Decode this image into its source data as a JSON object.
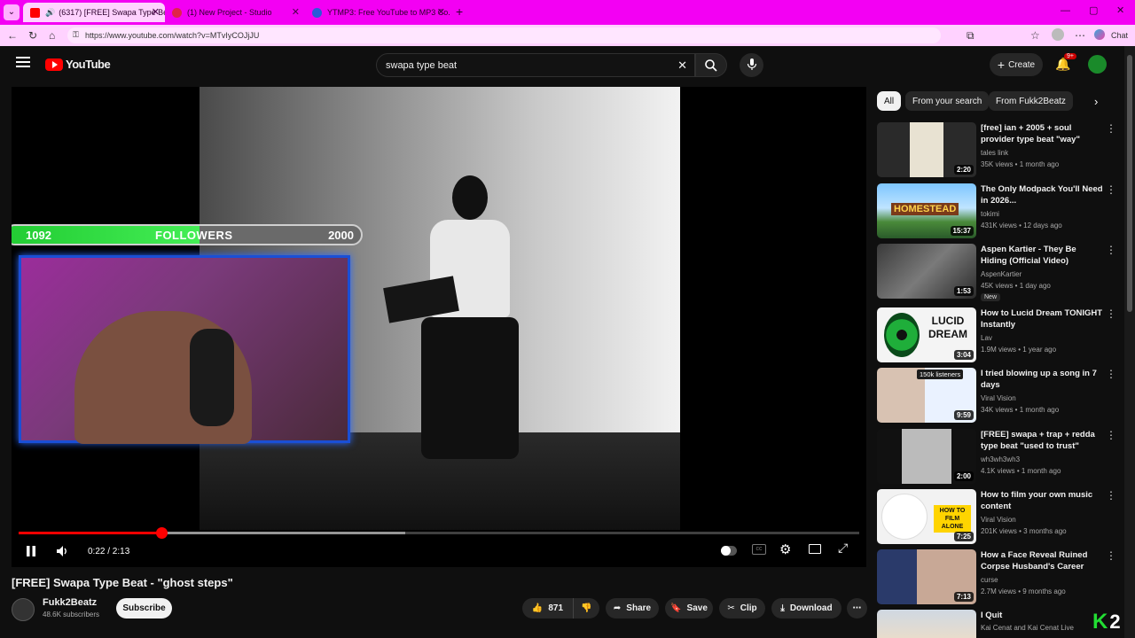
{
  "browser": {
    "tabs": [
      {
        "title": "(6317) [FREE] Swapa Type Be...",
        "active": true
      },
      {
        "title": "(1) New Project - Studio",
        "active": false
      },
      {
        "title": "YTMP3: Free YouTube to MP3 Co...",
        "active": false
      }
    ],
    "new_tab": "+",
    "url": "https://www.youtube.com/watch?v=MTvIyCOJjJU",
    "chat_label": "Chat"
  },
  "header": {
    "logo": "YouTube",
    "search_value": "swapa type beat",
    "create_label": "Create",
    "notif_count": "9+"
  },
  "overlay": {
    "followers_current": "1092",
    "followers_label": "FOLLOWERS",
    "followers_goal": "2000",
    "progress_fraction": 0.546
  },
  "player": {
    "time": "0:22 / 2:13",
    "played_fraction": 0.17,
    "buffered_fraction": 0.46
  },
  "video": {
    "title": "[FREE] Swapa Type Beat - \"ghost steps\"",
    "channel": "Fukk2Beatz",
    "subscribers": "48.6K subscribers",
    "subscribe_label": "Subscribe",
    "likes": "871",
    "share_label": "Share",
    "save_label": "Save",
    "clip_label": "Clip",
    "download_label": "Download"
  },
  "sidebar": {
    "chips": [
      "All",
      "From your search",
      "From Fukk2Beatz"
    ],
    "recs": [
      {
        "title": "[free] ian + 2005 + soul provider type beat \"way\"",
        "channel": "tales link",
        "meta": "35K views • 1 month ago",
        "duration": "2:20"
      },
      {
        "title": "The Only Modpack You'll Need in 2026...",
        "channel": "tokimi",
        "meta": "431K views • 12 days ago",
        "duration": "15:37"
      },
      {
        "title": "Aspen Kartier - They Be Hiding (Official Video)",
        "channel": "AspenKartier",
        "meta": "45K views • 1 day ago",
        "duration": "1:53",
        "badge": "New"
      },
      {
        "title": "How to Lucid Dream TONIGHT Instantly",
        "channel": "Lav",
        "meta": "1.9M views • 1 year ago",
        "duration": "3:04"
      },
      {
        "title": "I tried blowing up a song in 7 days",
        "channel": "Viral Vision",
        "meta": "34K views • 1 month ago",
        "duration": "9:59",
        "thumb_label": "150k listeners"
      },
      {
        "title": "[FREE] swapa + trap + redda type beat \"used to trust\"",
        "channel": "wh3wh3wh3",
        "meta": "4.1K views • 1 month ago",
        "duration": "2:00"
      },
      {
        "title": "How to film your own music content",
        "channel": "Viral Vision",
        "meta": "201K views • 3 months ago",
        "duration": "7:25",
        "thumb_label": "HOW TO FILM ALONE"
      },
      {
        "title": "How a Face Reveal Ruined Corpse Husband's Career",
        "channel": "curse",
        "meta": "2.7M views • 9 months ago",
        "duration": "7:13"
      },
      {
        "title": "I Quit",
        "channel": "Kai Cenat and Kai Cenat Live",
        "meta": "",
        "duration": ""
      }
    ],
    "thumb_texts": {
      "homestead": "HOMESTEAD",
      "lucid": "LUCID DREAM"
    }
  },
  "watermark": "2",
  "colors": {
    "accent": "#ff0000",
    "chrome": "#f300f3",
    "bg": "#0f0f0f"
  }
}
